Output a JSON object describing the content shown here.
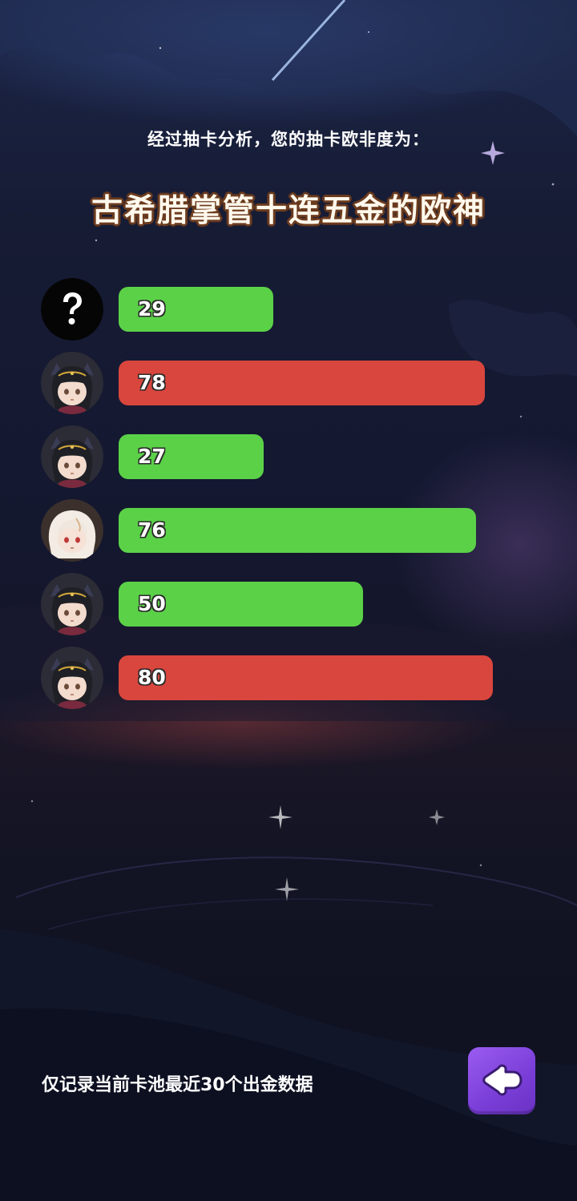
{
  "header": {
    "subtitle": "经过抽卡分析，您的抽卡欧非度为：",
    "title": "古希腊掌管十连五金的欧神"
  },
  "colors": {
    "good": "#5bd148",
    "bad": "#d9463d",
    "button": "#8a4ce6"
  },
  "pulls": [
    {
      "avatar": "unknown-question-icon",
      "value": "29",
      "status": "good",
      "level": 0.29
    },
    {
      "avatar": "dark-hair-character-icon",
      "value": "78",
      "status": "bad",
      "level": 0.78
    },
    {
      "avatar": "dark-hair-character-icon",
      "value": "27",
      "status": "good",
      "level": 0.27
    },
    {
      "avatar": "white-hair-character-icon",
      "value": "76",
      "status": "good",
      "level": 0.76
    },
    {
      "avatar": "dark-hair-character-icon",
      "value": "50",
      "status": "good",
      "level": 0.5
    },
    {
      "avatar": "dark-hair-character-icon",
      "value": "80",
      "status": "bad",
      "level": 0.8
    }
  ],
  "footer": {
    "note": "仅记录当前卡池最近30个出金数据",
    "back_icon": "back-arrow-icon"
  }
}
